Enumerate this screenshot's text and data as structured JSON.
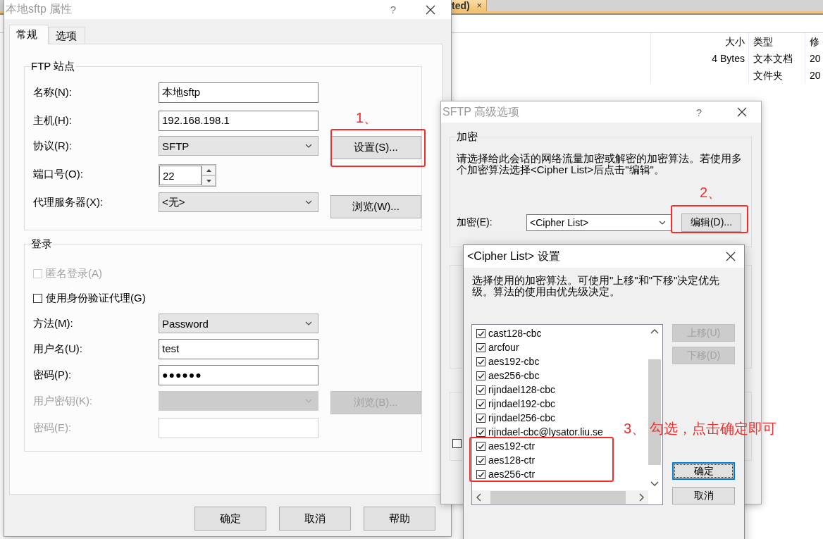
{
  "background_window": {
    "tab": {
      "label": "ted)",
      "close": "×"
    },
    "columns": [
      "大小",
      "类型",
      "修"
    ],
    "rows": [
      {
        "size": "4 Bytes",
        "type": "文本文档",
        "column_3": "20"
      },
      {
        "type": "文件夹",
        "column_3": "20"
      }
    ]
  },
  "main_dialog": {
    "title": "本地sftp 属性",
    "help": "?",
    "tabs": [
      {
        "label": "常规",
        "selected": true
      },
      {
        "label": "选项",
        "selected": false
      }
    ],
    "groups": [
      {
        "title": "FTP 站点",
        "rows": [
          {
            "kind": "text",
            "label": "名称(N):",
            "value": "本地sftp",
            "disabled": false
          },
          {
            "kind": "text",
            "label": "主机(H):",
            "value": "192.168.198.1",
            "disabled": false
          },
          {
            "kind": "combo",
            "label": "协议(R):",
            "value": "SFTP",
            "disabled": false,
            "button": {
              "label": "设置(S)...",
              "disabled": false,
              "annotation": "1、"
            }
          },
          {
            "kind": "spin",
            "label": "端口号(O):",
            "value": "22",
            "disabled": false
          },
          {
            "kind": "combo",
            "label": "代理服务器(X):",
            "value": "<无>",
            "disabled": false,
            "button": {
              "label": "浏览(W)...",
              "disabled": false
            }
          }
        ]
      },
      {
        "title": "登录",
        "rows": [
          {
            "kind": "checkbox",
            "label": "匿名登录(A)",
            "checked": false,
            "disabled": true
          },
          {
            "kind": "checkbox",
            "label": "使用身份验证代理(G)",
            "checked": false,
            "disabled": false
          },
          {
            "kind": "combo",
            "label": "方法(M):",
            "value": "Password",
            "disabled": false
          },
          {
            "kind": "text",
            "label": "用户名(U):",
            "value": "test",
            "disabled": false
          },
          {
            "kind": "password",
            "label": "密码(P):",
            "value": "●●●●●●",
            "disabled": false
          },
          {
            "kind": "combo",
            "label": "用户密钥(K):",
            "disabled": true,
            "button": {
              "label": "浏览(B)...",
              "disabled": true
            }
          },
          {
            "kind": "text",
            "label": "密码(E):",
            "disabled": true
          }
        ]
      }
    ],
    "buttons": [
      {
        "label": "确定"
      },
      {
        "label": "取消"
      },
      {
        "label": "帮助"
      }
    ]
  },
  "sftp_dialog": {
    "title": "SFTP 高级选项",
    "help": "?",
    "encryption": {
      "title": "加密",
      "description_lines": [
        "请选择给此会话的网络流量加密或解密的加密算法。若使用多",
        "个加密算法选择<Cipher List>后点击\"编辑\"。"
      ],
      "label": "加密(E):",
      "value": "<Cipher List>",
      "button": {
        "label": "编辑(D)...",
        "annotation": "2、"
      }
    },
    "group_3": {
      "checkbox": {
        "checked": false
      }
    }
  },
  "cipher_dialog": {
    "title": "<Cipher List> 设置",
    "description_lines": [
      "选择使用的加密算法。可使用\"上移\"和\"下移\"决定优先",
      "级。算法的使用由优先级决定。"
    ],
    "ciphers": [
      {
        "label": "cast128-cbc",
        "checked": true
      },
      {
        "label": "arcfour",
        "checked": true
      },
      {
        "label": "aes192-cbc",
        "checked": true
      },
      {
        "label": "aes256-cbc",
        "checked": true
      },
      {
        "label": "rijndael128-cbc",
        "checked": true
      },
      {
        "label": "rijndael192-cbc",
        "checked": true
      },
      {
        "label": "rijndael256-cbc",
        "checked": true
      },
      {
        "label": "rijndael-cbc@lysator.liu.se",
        "checked": true
      },
      {
        "label": "aes192-ctr",
        "checked": true
      },
      {
        "label": "aes128-ctr",
        "checked": true
      },
      {
        "label": "aes256-ctr",
        "checked": true
      }
    ],
    "buttons": [
      {
        "kind": "move",
        "label": "上移(U)",
        "disabled": true,
        "default": false
      },
      {
        "kind": "move",
        "label": "下移(D)",
        "disabled": true,
        "default": false
      },
      {
        "kind": "confirm",
        "label": "确定",
        "disabled": false,
        "default": true
      },
      {
        "kind": "confirm",
        "label": "取消",
        "disabled": false,
        "default": false
      }
    ],
    "annotation": "3、 勾选，点击确定即可"
  }
}
